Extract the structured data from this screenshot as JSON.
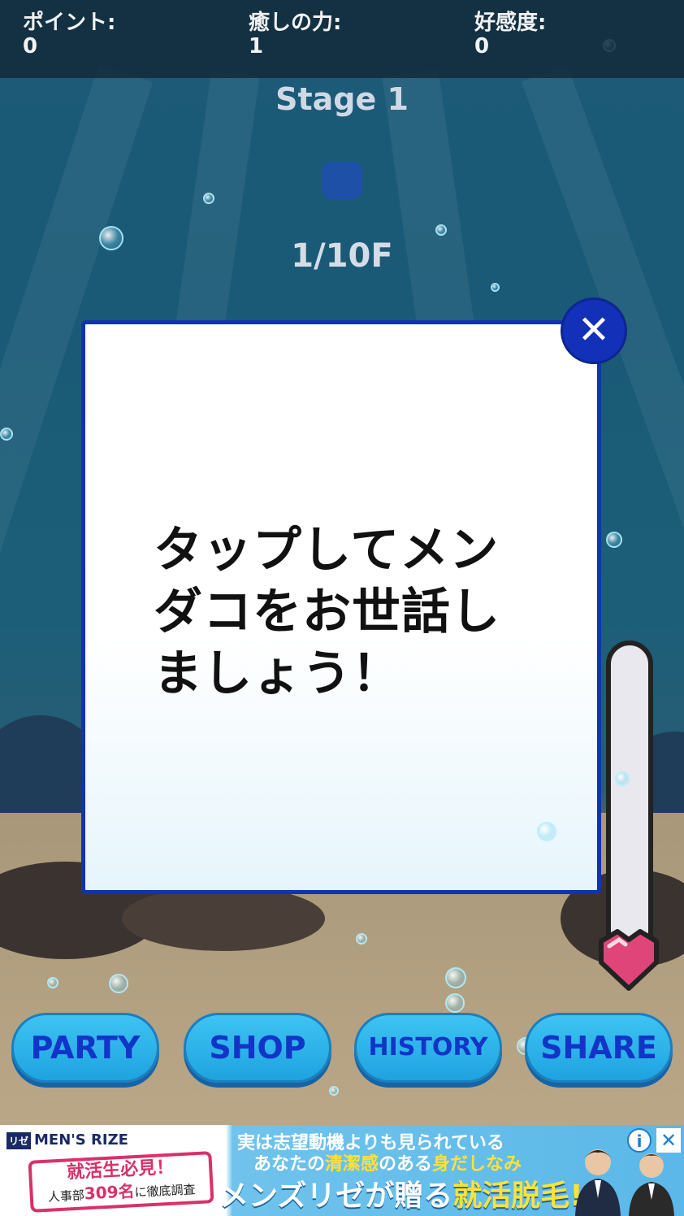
{
  "stats": [
    {
      "label": "ポイント:",
      "value": "0"
    },
    {
      "label": "癒しの力:",
      "value": "1"
    },
    {
      "label": "好感度:",
      "value": "0"
    }
  ],
  "stage": "Stage 1",
  "floor": "1/10F",
  "modal": {
    "message_lines": [
      "タップしてメン",
      "ダコをお世話し",
      "ましょう！"
    ],
    "close_label": "✕"
  },
  "buttons": [
    {
      "label": "PARTY"
    },
    {
      "label": "SHOP"
    },
    {
      "label": "HISTORY"
    },
    {
      "label": "SHARE"
    }
  ],
  "ad": {
    "brand": "MEN'S RIZE",
    "badge_line1": "就活生必見！",
    "badge_line2_pre": "人事部",
    "badge_line2_num": "309名",
    "badge_line2_post": "に徹底調査",
    "line1": "実は志望動機よりも見られている",
    "line2_pre": "あなたの",
    "line2_hl1": "清潔感",
    "line2_mid": "のある",
    "line2_hl2": "身だしなみ",
    "line3_pre": "メンズリゼが贈る",
    "line3_hl": "就活脱毛!",
    "info": "i",
    "close": "✕"
  },
  "colors": {
    "modal_border": "#1233b0",
    "button_fill": "#2fb3ea",
    "button_text": "#1235c8",
    "close_button": "#1230b8",
    "heart": "#e0457a"
  },
  "icons": [
    "close-icon",
    "heart-icon",
    "info-icon",
    "ad-close-icon"
  ]
}
